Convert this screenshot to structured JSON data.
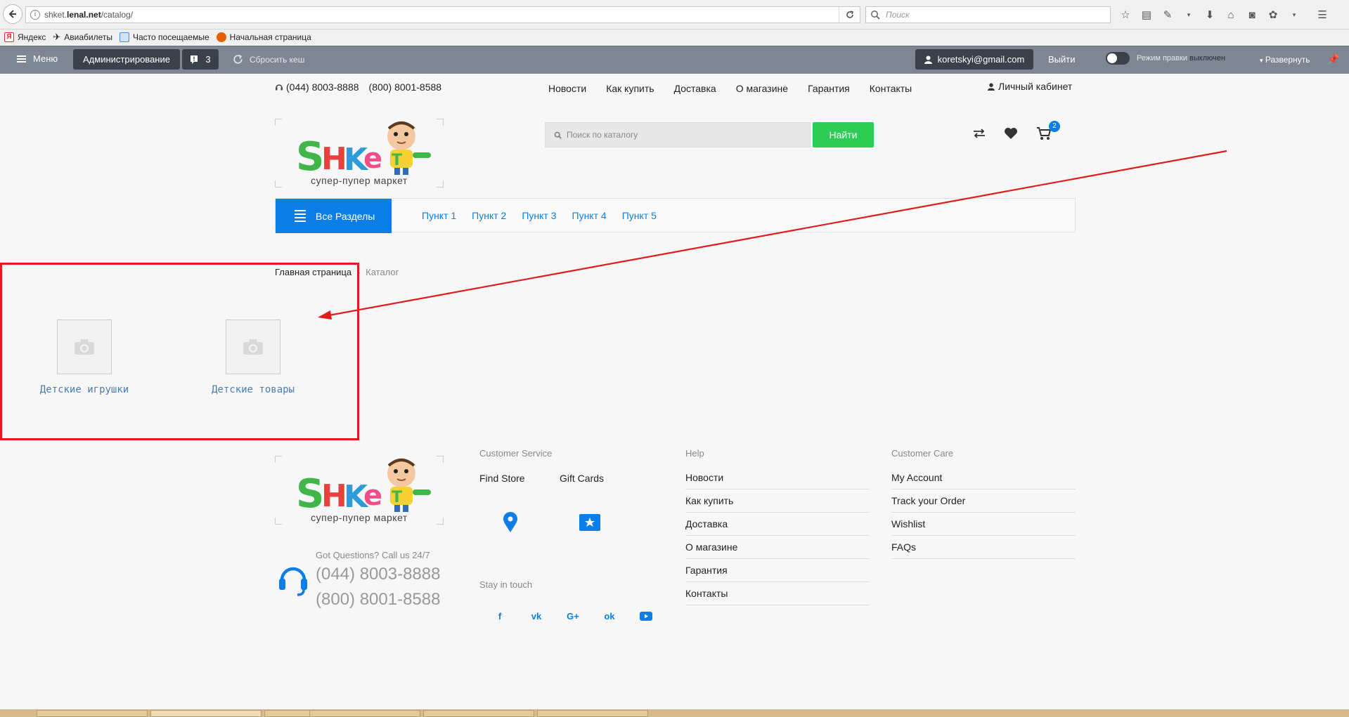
{
  "browser": {
    "url": "shket.lenal.net/catalog/",
    "url_domain": "shket.",
    "url_domain_bold": "lenal.net",
    "url_path": "/catalog/",
    "search_placeholder": "Поиск",
    "bookmarks": [
      {
        "label": "Яндекс",
        "icon": "yandex-icon",
        "color": "#e8242c"
      },
      {
        "label": "Авиабилеты",
        "icon": "plane-icon",
        "color": "#333333"
      },
      {
        "label": "Часто посещаемые",
        "icon": "history-icon",
        "color": "#4a90d9"
      },
      {
        "label": "Начальная страница",
        "icon": "firefox-icon",
        "color": "#e66000"
      }
    ]
  },
  "admin": {
    "menu_label": "Меню",
    "admin_label": "Администрирование",
    "notifications_count": "3",
    "clear_cache_label": "Сбросить кеш",
    "user_email": "koretskyi@gmail.com",
    "logout_label": "Выйти",
    "edit_mode_label": "Режим правки",
    "edit_mode_state": "выключен",
    "expand_label": "Развернуть"
  },
  "header": {
    "phone1": "(044) 8003-8888",
    "phone2": "(800) 8001-8588",
    "nav": [
      "Новости",
      "Как купить",
      "Доставка",
      "О магазине",
      "Гарантия",
      "Контакты"
    ],
    "cabinet_label": "Личный кабинет",
    "logo_text": "Shket",
    "logo_subtitle": "супер-пупер маркет",
    "search_placeholder": "Поиск по каталогу",
    "search_button": "Найти",
    "cart_count": "2"
  },
  "category_bar": {
    "all_sections": "Все Разделы",
    "items": [
      "Пункт 1",
      "Пункт 2",
      "Пункт 3",
      "Пункт 4",
      "Пункт 5"
    ]
  },
  "breadcrumb": {
    "home": "Главная страница",
    "current": "Каталог"
  },
  "catalog": {
    "categories": [
      "Детские игрушки",
      "Детские товары"
    ]
  },
  "footer": {
    "logo_subtitle": "супер-пупер маркет",
    "support_question": "Got Questions? Call us 24/7",
    "phone1": "(044) 8003-8888",
    "phone2": "(800) 8001-8588",
    "customer_service_title": "Customer Service",
    "find_store": "Find Store",
    "gift_cards": "Gift Cards",
    "stay_in_touch": "Stay in touch",
    "help_title": "Help",
    "help_links": [
      "Новости",
      "Как купить",
      "Доставка",
      "О магазине",
      "Гарантия",
      "Контакты"
    ],
    "care_title": "Customer Care",
    "care_links": [
      "My Account",
      "Track your Order",
      "Wishlist",
      "FAQs"
    ]
  },
  "colors": {
    "accent_blue": "#0d7ee8",
    "find_green": "#2ecc55",
    "annotation_red": "#e01c1c",
    "admin_bar": "#7e8694"
  }
}
